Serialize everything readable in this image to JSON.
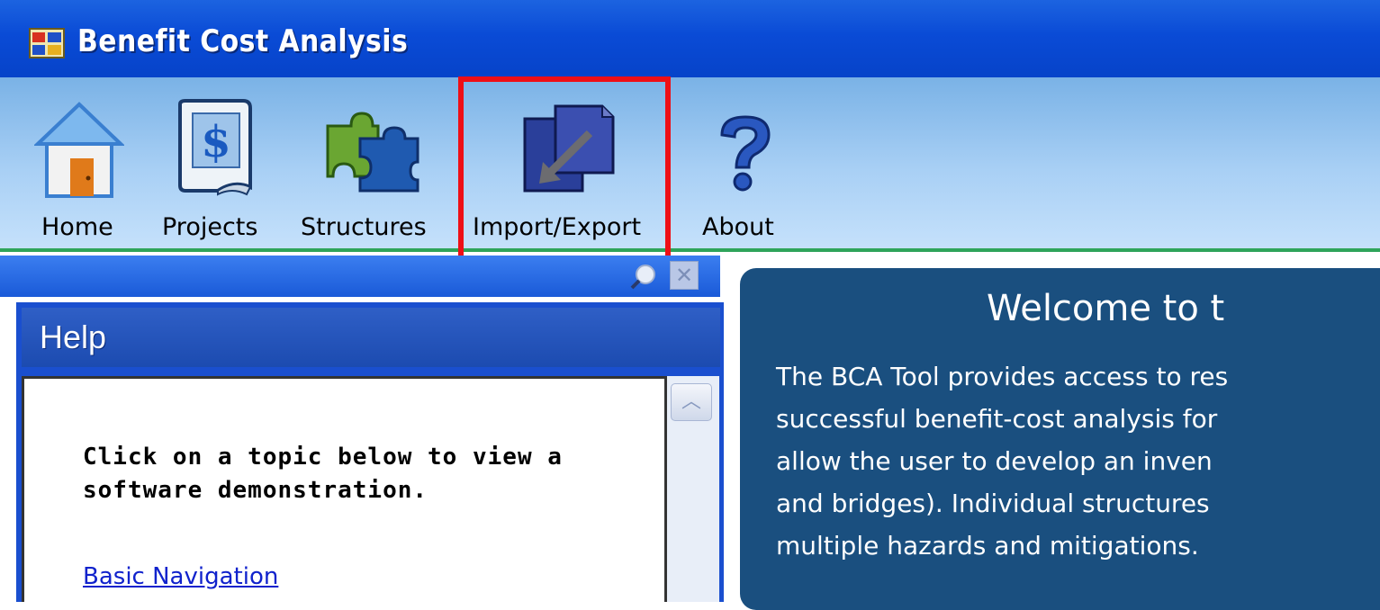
{
  "window": {
    "title": "Benefit Cost Analysis",
    "app_icon": "app-window-icon"
  },
  "toolbar": {
    "buttons": [
      {
        "label": "Home",
        "icon": "house-icon"
      },
      {
        "label": "Projects",
        "icon": "dollar-document-icon"
      },
      {
        "label": "Structures",
        "icon": "puzzle-pieces-icon"
      },
      {
        "label": "Import/Export",
        "icon": "import-export-icon",
        "highlighted": true
      },
      {
        "label": "About",
        "icon": "question-mark-icon"
      }
    ],
    "highlight_color": "#ee0f16"
  },
  "help_panel": {
    "title": "Help",
    "intro": "Click on a topic below to view a software demonstration.",
    "link": "Basic Navigation"
  },
  "welcome_panel": {
    "title": "Welcome to t",
    "body": "The BCA Tool provides access to res\nsuccessful benefit-cost analysis for\nallow the user to develop an inven\nand bridges). Individual structures\nmultiple hazards and mitigations."
  }
}
